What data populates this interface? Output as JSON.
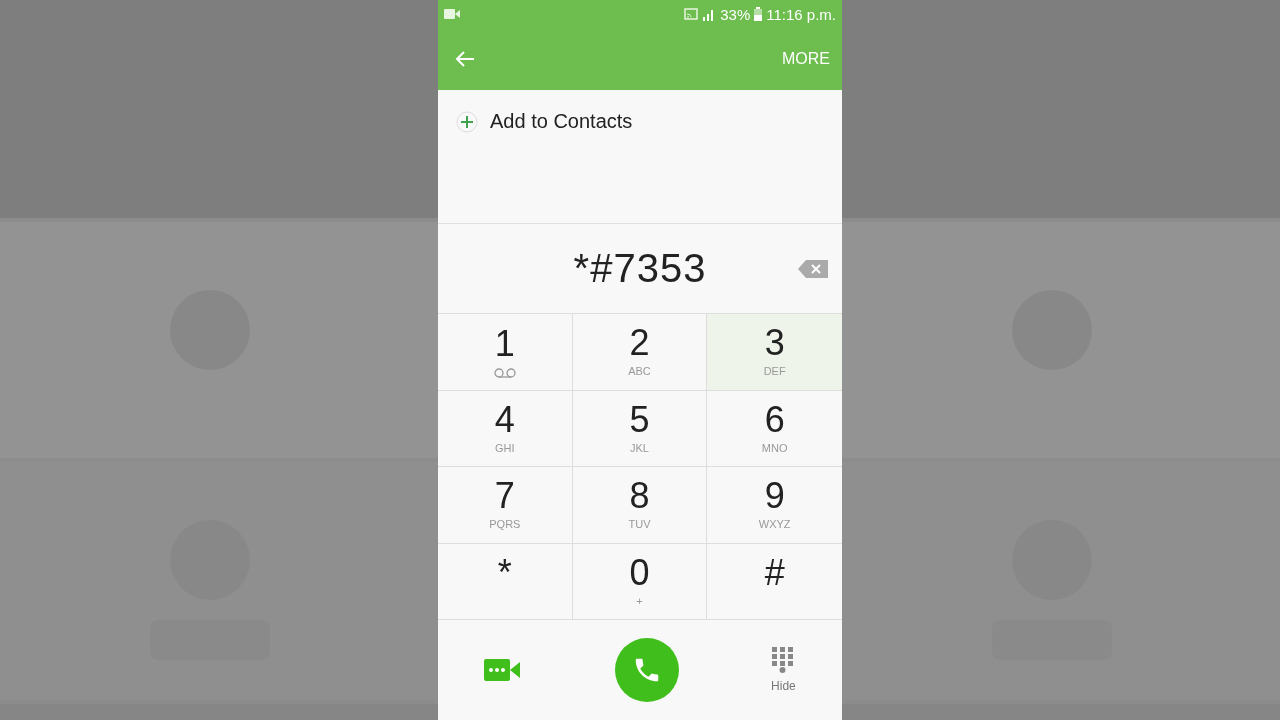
{
  "status_bar": {
    "battery": "33%",
    "time": "11:16 p.m."
  },
  "toolbar": {
    "more": "MORE"
  },
  "add_contact": {
    "label": "Add to Contacts"
  },
  "dialed": {
    "value": "*#7353"
  },
  "keys": [
    {
      "digit": "1",
      "kind": "voicemail",
      "pressed": false
    },
    {
      "digit": "2",
      "letters": "ABC",
      "kind": "letters",
      "pressed": false
    },
    {
      "digit": "3",
      "letters": "DEF",
      "kind": "letters",
      "pressed": true
    },
    {
      "digit": "4",
      "letters": "GHI",
      "kind": "letters",
      "pressed": false
    },
    {
      "digit": "5",
      "letters": "JKL",
      "kind": "letters",
      "pressed": false
    },
    {
      "digit": "6",
      "letters": "MNO",
      "kind": "letters",
      "pressed": false
    },
    {
      "digit": "7",
      "letters": "PQRS",
      "kind": "letters",
      "pressed": false
    },
    {
      "digit": "8",
      "letters": "TUV",
      "kind": "letters",
      "pressed": false
    },
    {
      "digit": "9",
      "letters": "WXYZ",
      "kind": "letters",
      "pressed": false
    },
    {
      "digit": "*",
      "kind": "symbol",
      "pressed": false
    },
    {
      "digit": "0",
      "letters": "+",
      "kind": "letters",
      "pressed": false
    },
    {
      "digit": "#",
      "kind": "symbol",
      "pressed": false
    }
  ],
  "bottom": {
    "hide": "Hide"
  }
}
